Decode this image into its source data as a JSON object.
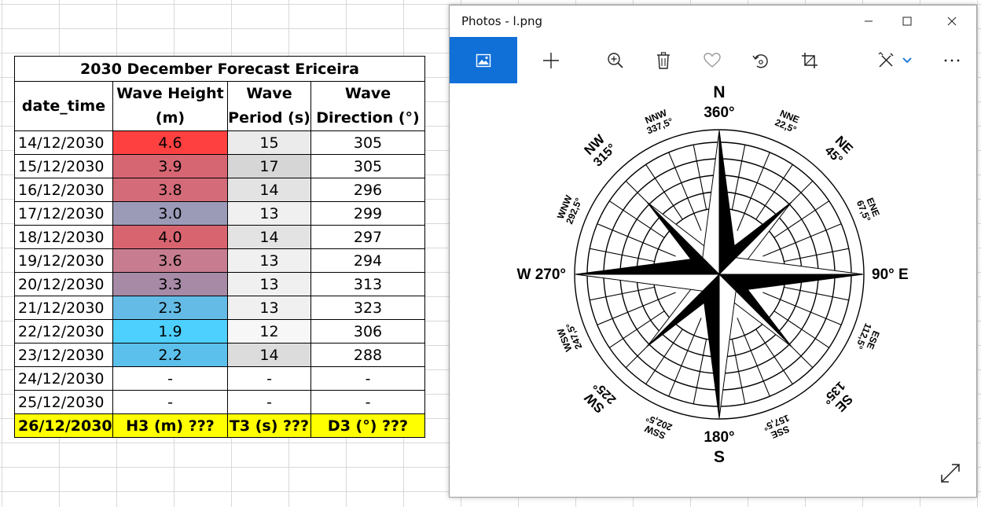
{
  "sheet": {
    "title": "2030 December Forecast Ericeira",
    "headers": {
      "date": "date_time",
      "height_l1": "Wave Height",
      "height_l2": "(m)",
      "period_l1": "Wave",
      "period_l2": "Period (s)",
      "dir_l1": "Wave",
      "dir_l2": "Direction (°)"
    },
    "rows": [
      {
        "date": "14/12/2030",
        "height": "4.6",
        "period": "15",
        "direction": "305",
        "height_color": "#ff4040",
        "period_color": "#ebebeb"
      },
      {
        "date": "15/12/2030",
        "height": "3.9",
        "period": "17",
        "direction": "305",
        "height_color": "#d76673",
        "period_color": "#d6d6d6"
      },
      {
        "date": "16/12/2030",
        "height": "3.8",
        "period": "14",
        "direction": "296",
        "height_color": "#d46b78",
        "period_color": "#e3e3e3"
      },
      {
        "date": "17/12/2030",
        "height": "3.0",
        "period": "13",
        "direction": "299",
        "height_color": "#9b9bb8",
        "period_color": "#f0f0f0"
      },
      {
        "date": "18/12/2030",
        "height": "4.0",
        "period": "14",
        "direction": "297",
        "height_color": "#d86470",
        "period_color": "#e3e3e3"
      },
      {
        "date": "19/12/2030",
        "height": "3.6",
        "period": "13",
        "direction": "294",
        "height_color": "#c77d8f",
        "period_color": "#f0f0f0"
      },
      {
        "date": "20/12/2030",
        "height": "3.3",
        "period": "13",
        "direction": "313",
        "height_color": "#a68aa6",
        "period_color": "#f0f0f0"
      },
      {
        "date": "21/12/2030",
        "height": "2.3",
        "period": "13",
        "direction": "323",
        "height_color": "#64bce6",
        "period_color": "#f0f0f0"
      },
      {
        "date": "22/12/2030",
        "height": "1.9",
        "period": "12",
        "direction": "306",
        "height_color": "#4ed0ff",
        "period_color": "#f7f7f7"
      },
      {
        "date": "23/12/2030",
        "height": "2.2",
        "period": "14",
        "direction": "288",
        "height_color": "#5cc0ec",
        "period_color": "#dcdcdc"
      },
      {
        "date": "24/12/2030",
        "height": "-",
        "period": "-",
        "direction": "-",
        "height_color": "#ffffff",
        "period_color": "#ffffff"
      },
      {
        "date": "25/12/2030",
        "height": "-",
        "period": "-",
        "direction": "-",
        "height_color": "#ffffff",
        "period_color": "#ffffff"
      }
    ],
    "target": {
      "date": "26/12/2030",
      "height": "H3 (m) ???",
      "period": "T3 (s) ???",
      "direction": "D3 (°) ???",
      "color": "#ffff00"
    }
  },
  "window": {
    "title": "Photos - l.png",
    "minimize_icon": "minimize-icon",
    "maximize_icon": "maximize-icon",
    "close_icon": "close-icon",
    "accent": "#1070d8"
  },
  "toolbar": {
    "icons": [
      "image-icon",
      "add-icon",
      "zoom-in-icon",
      "delete-icon",
      "heart-icon",
      "rotate-icon",
      "crop-icon",
      "edit-draw-icon",
      "chevron-down-icon",
      "more-icon"
    ]
  },
  "compass": {
    "labels": {
      "n": "N",
      "n_deg": "360°",
      "s": "S",
      "s_deg": "180°",
      "e": "90° E",
      "w": "W 270°",
      "ne": "NE",
      "ne_deg": "45°",
      "nw": "NW",
      "nw_deg": "315°",
      "se": "SE",
      "se_deg": "135°",
      "sw": "SW",
      "sw_deg": "225°",
      "nne": "NNE",
      "nne_deg": "22,5°",
      "nnw": "NNW",
      "nnw_deg": "337,5°",
      "ene": "ENE",
      "ene_deg": "67,5°",
      "wnw": "WNW",
      "wnw_deg": "292,5°",
      "ese": "ESE",
      "ese_deg": "112,5°",
      "wsw": "WSW",
      "wsw_deg": "247,5°",
      "sse": "SSE",
      "sse_deg": "157,5°",
      "ssw": "SSW",
      "ssw_deg": "202,5°"
    }
  }
}
